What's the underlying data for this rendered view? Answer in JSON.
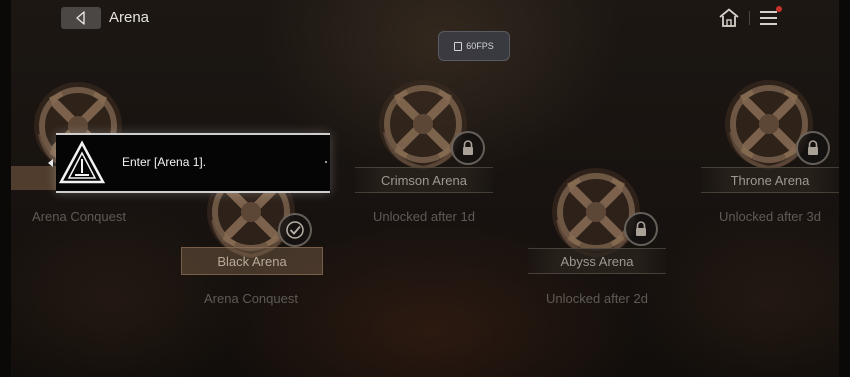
{
  "header": {
    "title": "Arena",
    "fps": "60FPS"
  },
  "tooltip": {
    "text": "Enter [Arena 1]."
  },
  "arenas": [
    {
      "name": "",
      "subtitle": "Arena Conquest",
      "status": "highlighted"
    },
    {
      "name": "Black Arena",
      "subtitle": "Arena Conquest",
      "status": "completed"
    },
    {
      "name": "Crimson Arena",
      "subtitle": "Unlocked after 1d",
      "status": "locked"
    },
    {
      "name": "Abyss Arena",
      "subtitle": "Unlocked after 2d",
      "status": "locked"
    },
    {
      "name": "Throne Arena",
      "subtitle": "Unlocked after 3d",
      "status": "locked"
    }
  ],
  "colors": {
    "emblem": "#8a6e55",
    "badge_border": "#a9a096",
    "menu_alert": "#c8322a"
  },
  "icons": [
    "back-arrow-icon",
    "home-icon",
    "menu-icon",
    "lock-icon",
    "check-icon",
    "arena-emblem-icon",
    "warning-triangle-icon"
  ]
}
